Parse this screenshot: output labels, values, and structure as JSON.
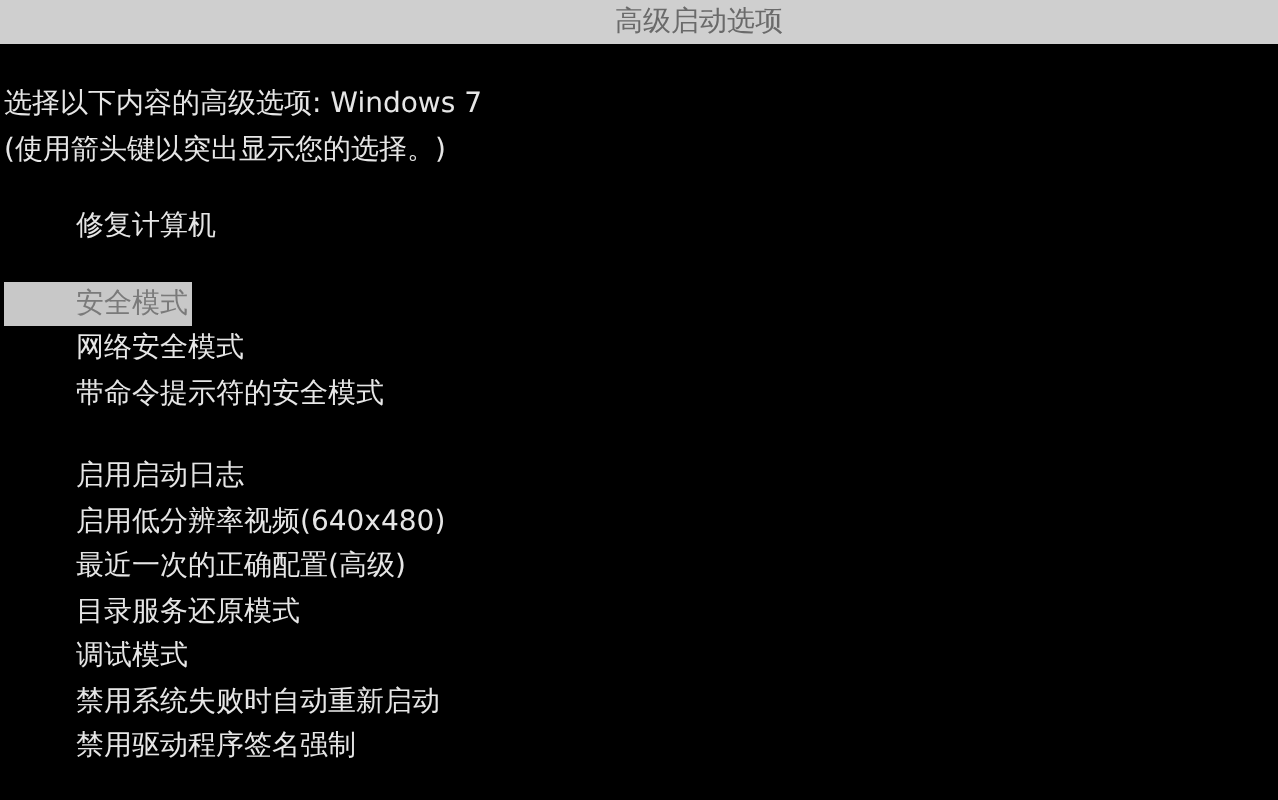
{
  "window": {
    "title": "高级启动选项"
  },
  "prompt": [
    "选择以下内容的高级选项: Windows 7",
    "(使用箭头键以突出显示您的选择。)"
  ],
  "option_groups": [
    {
      "options": [
        {
          "label": "修复计算机",
          "selected": false
        }
      ]
    },
    {
      "options": [
        {
          "label": "安全模式",
          "selected": true
        },
        {
          "label": "网络安全模式",
          "selected": false
        },
        {
          "label": "带命令提示符的安全模式",
          "selected": false
        }
      ]
    },
    {
      "options": [
        {
          "label": "启用启动日志",
          "selected": false
        },
        {
          "label": "启用低分辨率视频(640x480)",
          "selected": false
        },
        {
          "label": "最近一次的正确配置(高级)",
          "selected": false
        },
        {
          "label": "目录服务还原模式",
          "selected": false
        },
        {
          "label": "调试模式",
          "selected": false
        },
        {
          "label": "禁用系统失败时自动重新启动",
          "selected": false
        },
        {
          "label": "禁用驱动程序签名强制",
          "selected": false
        }
      ]
    }
  ]
}
